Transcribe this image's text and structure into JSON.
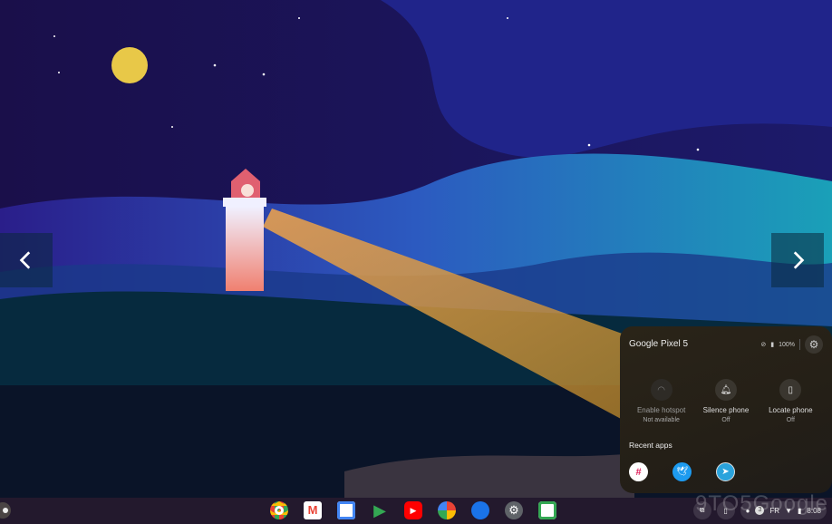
{
  "phone_hub": {
    "title": "Google Pixel 5",
    "battery": "100%",
    "actions": [
      {
        "label": "Enable hotspot",
        "status": "Not available",
        "icon": "hotspot-icon"
      },
      {
        "label": "Silence phone",
        "status": "Off",
        "icon": "bell-icon"
      },
      {
        "label": "Locate phone",
        "status": "Off",
        "icon": "locate-phone-icon"
      }
    ],
    "recent_label": "Recent apps",
    "recent_apps": [
      "slack",
      "twitter",
      "telegram"
    ]
  },
  "shelf": {
    "apps": [
      "chrome",
      "gmail",
      "calendar",
      "play-store",
      "youtube",
      "photos",
      "messages",
      "settings",
      "slides"
    ],
    "tray": {
      "ime": "FR",
      "time": "8:08",
      "notification_count": "3"
    }
  },
  "watermark": "9TO5Google",
  "colors": {
    "accent": "#1a73e8"
  }
}
